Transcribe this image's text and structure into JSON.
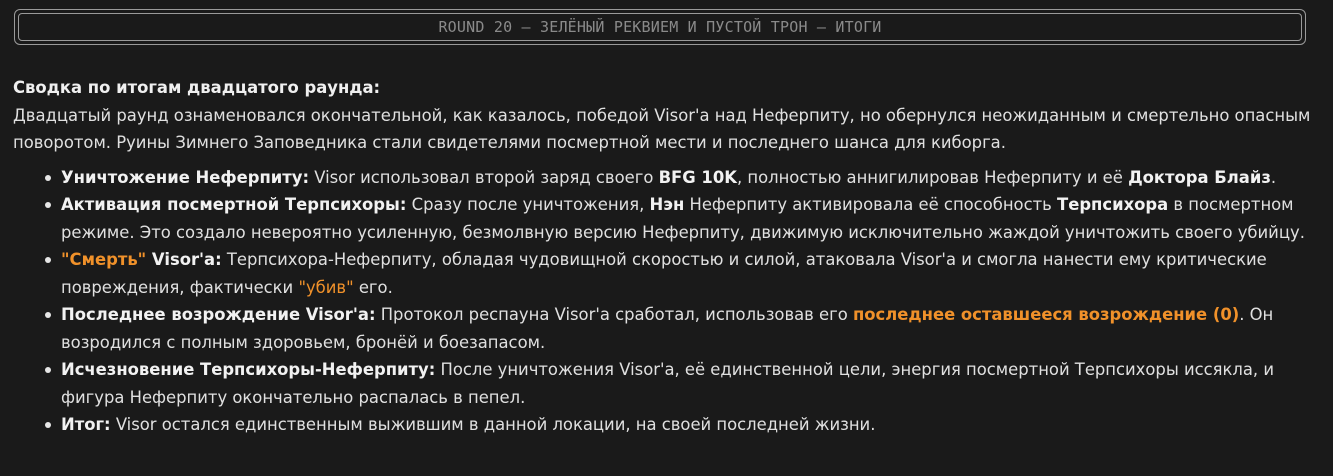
{
  "title": "ROUND 20 – ЗЕЛЁНЫЙ РЕКВИЕМ И ПУСТОЙ ТРОН – ИТОГИ",
  "summary": {
    "heading": "Сводка по итогам двадцатого раунда:",
    "text": "Двадцатый раунд ознаменовался окончательной, как казалось, победой Visor'а над Неферпиту, но обернулся неожиданным и смертельно опасным поворотом. Руины Зимнего Заповедника стали свидетелями посмертной мести и последнего шанса для киборга."
  },
  "items": [
    {
      "label": "Уничтожение Неферпиту:",
      "t1": " Visor использовал второй заряд своего ",
      "b1": "BFG 10K",
      "t2": ", полностью аннигилировав Неферпиту и её ",
      "b2": "Доктора Блайз",
      "t3": "."
    },
    {
      "label": "Активация посмертной Терпсихоры:",
      "t1": " Сразу после уничтожения, ",
      "b1": "Нэн",
      "t2": " Неферпиту активировала её способность ",
      "b2": "Терпсихора",
      "t3": " в посмертном режиме. Это создало невероятно усиленную, безмолвную версию Неферпиту, движимую исключительно жаждой уничтожить своего убийцу."
    },
    {
      "label_orange": "\"Смерть\"",
      "label": " Visor'а:",
      "t1": " Терпсихора-Неферпиту, обладая чудовищной скоростью и силой, атаковала Visor'а и смогла нанести ему критические повреждения, фактически ",
      "o1": "\"убив\"",
      "t2": " его."
    },
    {
      "label": "Последнее возрождение Visor'а:",
      "t1": " Протокол респауна Visor'а сработал, использовав его ",
      "o1": "последнее оставшееся возрождение (0)",
      "t2": ". Он возродился с полным здоровьем, бронёй и боезапасом."
    },
    {
      "label": "Исчезновение Терпсихоры-Неферпиту:",
      "t1": " После уничтожения Visor'а, её единственной цели, энергия посмертной Терпсихоры иссякла, и фигура Неферпиту окончательно распалась в пепел."
    },
    {
      "label": "Итог:",
      "t1": " Visor остался единственным выжившим в данной локации, на своей последней жизни."
    }
  ]
}
